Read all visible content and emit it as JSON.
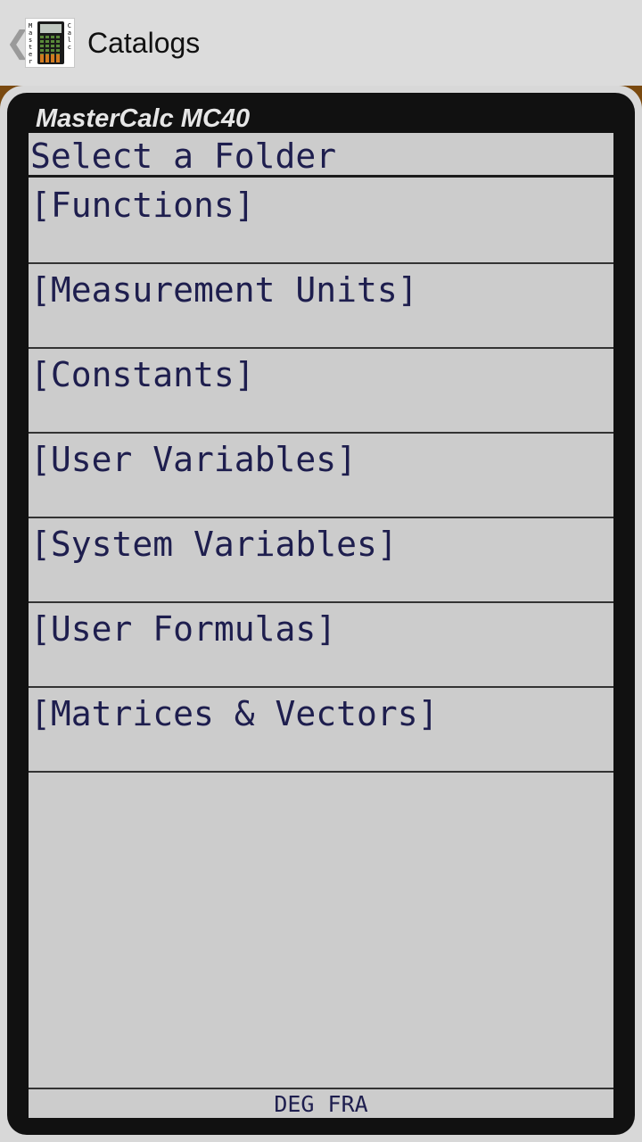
{
  "action_bar": {
    "title": "Catalogs",
    "back_glyph": "❮",
    "app_icon": "mastercalc-app-icon",
    "icon_letters_left": "Master",
    "icon_letters_right": "Calc"
  },
  "calculator": {
    "brand": "MasterCalc MC40",
    "header": "Select a Folder",
    "folders": [
      "[Functions]",
      "[Measurement Units]",
      "[Constants]",
      "[User Variables]",
      "[System Variables]",
      "[User Formulas]",
      "[Matrices & Vectors]"
    ],
    "status": {
      "angle_mode": "DEG",
      "number_mode": "FRA"
    }
  },
  "colors": {
    "action_bar_bg": "#dcdcdc",
    "calc_body": "#111111",
    "lcd_bg": "#cccccc",
    "lcd_text": "#1e1e4e",
    "frame_brown": "#7a4a10"
  }
}
